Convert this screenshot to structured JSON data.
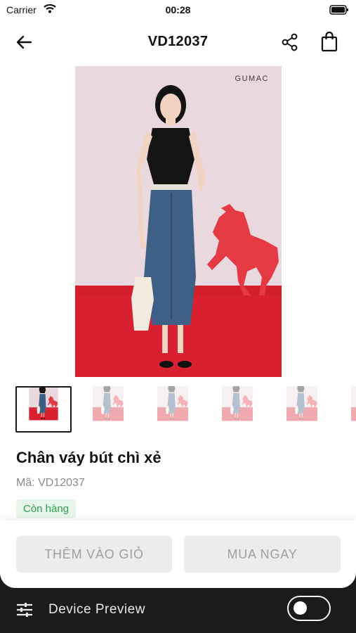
{
  "status_bar": {
    "carrier": "Carrier",
    "time": "00:28"
  },
  "header": {
    "title": "VD12037"
  },
  "main_image": {
    "brand": "GUMAC"
  },
  "gallery": {
    "thumbnail_count": 6,
    "active_index": 0
  },
  "product": {
    "name": "Chân váy bút chì xẻ",
    "sku": "Mã: VD12037",
    "stock_status": "Còn hàng"
  },
  "actions": {
    "add_to_cart": "THÊM VÀO GIỎ",
    "buy_now": "MUA NGAY"
  },
  "device_preview": {
    "label": "Device Preview",
    "enabled": false
  },
  "icons": [
    "wifi-icon",
    "battery-icon",
    "back-arrow-icon",
    "share-icon",
    "shopping-bag-icon",
    "tune-icon"
  ],
  "colors": {
    "in_stock_text": "#2e9e48",
    "in_stock_bg": "#e7f6ea",
    "button_disabled": "#ececec"
  }
}
